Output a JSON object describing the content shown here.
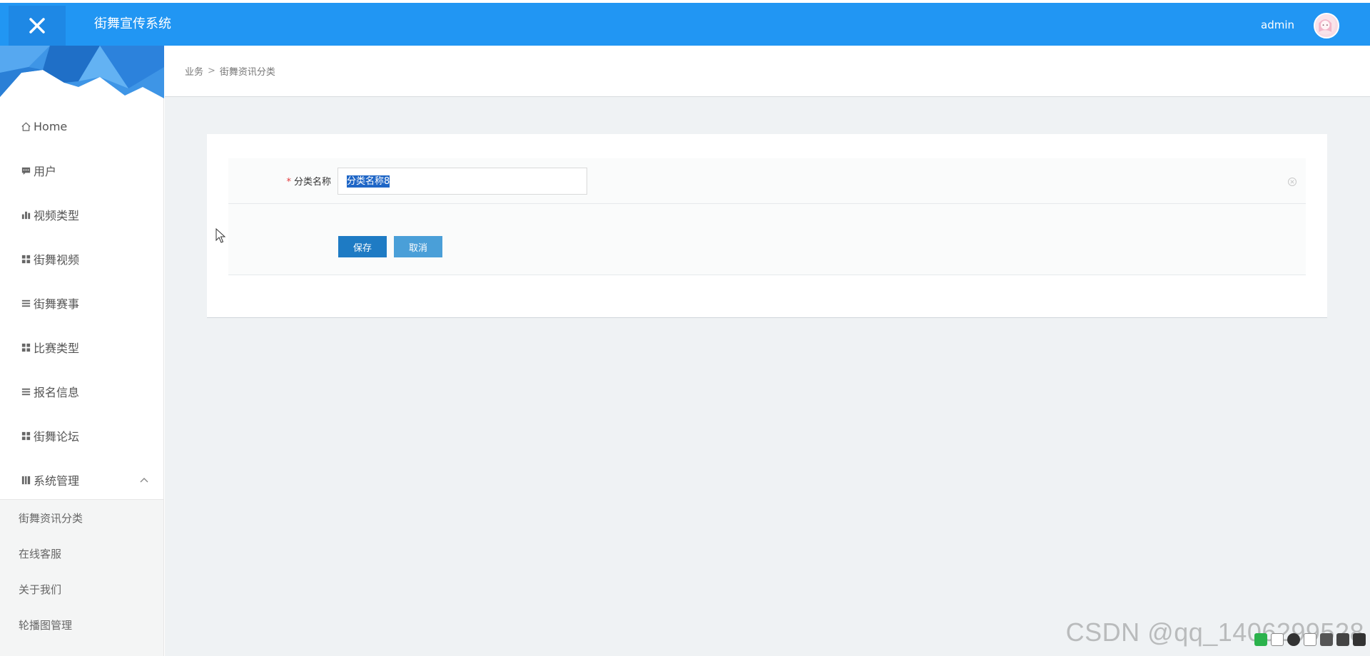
{
  "header": {
    "close_icon": "close-icon",
    "app_title": "街舞宣传系统",
    "user_name": "admin",
    "brand_color": "#2196f3"
  },
  "sidebar": {
    "items": [
      {
        "label": "Home",
        "icon": "home-icon"
      },
      {
        "label": "用户",
        "icon": "comment-icon"
      },
      {
        "label": "视频类型",
        "icon": "bar-chart-icon"
      },
      {
        "label": "街舞视频",
        "icon": "grid-icon"
      },
      {
        "label": "街舞赛事",
        "icon": "list-icon"
      },
      {
        "label": "比赛类型",
        "icon": "grid-icon"
      },
      {
        "label": "报名信息",
        "icon": "list-icon"
      },
      {
        "label": "街舞论坛",
        "icon": "grid-icon"
      },
      {
        "label": "系统管理",
        "icon": "book-icon",
        "expanded": true
      }
    ],
    "submenu": [
      {
        "label": "街舞资讯分类"
      },
      {
        "label": "在线客服"
      },
      {
        "label": "关于我们"
      },
      {
        "label": "轮播图管理"
      }
    ]
  },
  "breadcrumb": {
    "parent": "业务",
    "separator": ">",
    "current": "街舞资讯分类"
  },
  "form": {
    "required_mark": "*",
    "field_label": "分类名称",
    "field_value": "分类名称8",
    "save_label": "保存",
    "cancel_label": "取消"
  },
  "watermark": "CSDN @qq_1406299528"
}
